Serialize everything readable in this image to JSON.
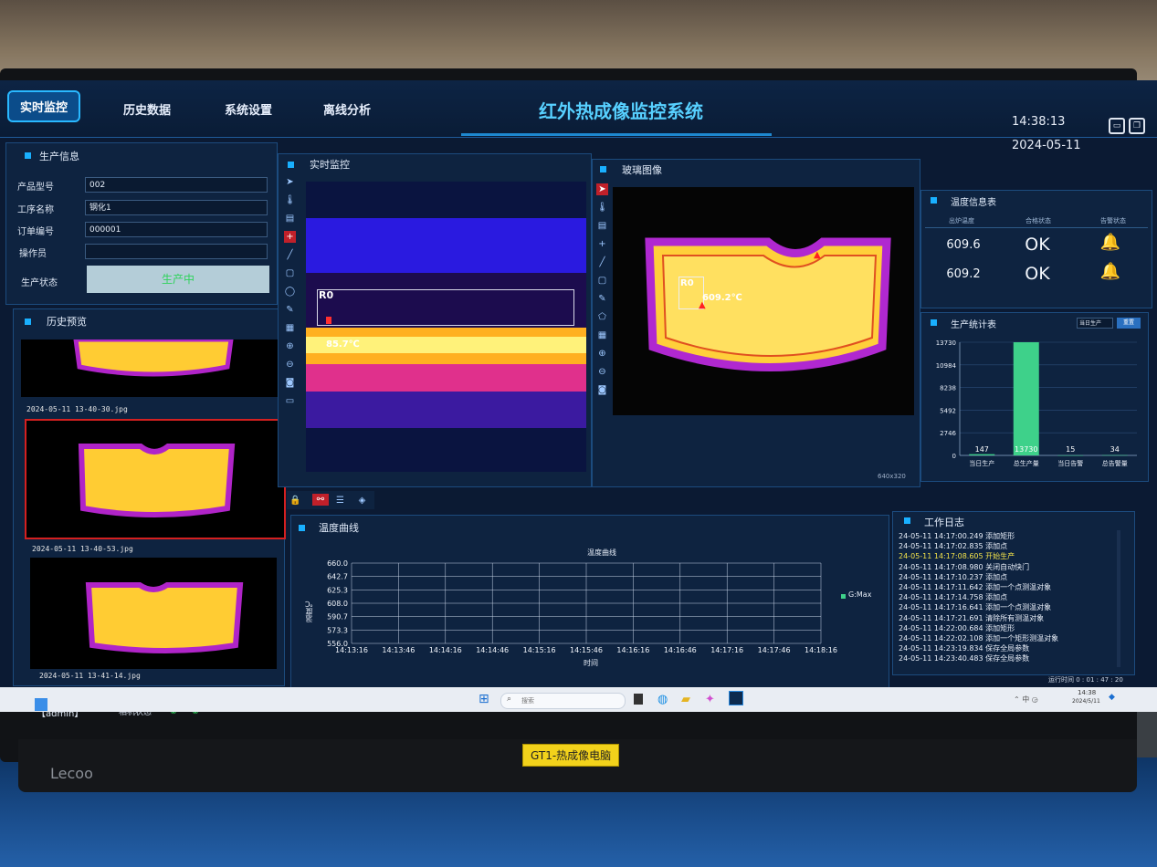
{
  "header": {
    "tabs": [
      "实时监控",
      "历史数据",
      "系统设置",
      "离线分析"
    ],
    "title": "红外热成像监控系统",
    "time": "14:38:13",
    "date": "2024-05-11"
  },
  "production_info": {
    "title": "生产信息",
    "fields": [
      {
        "label": "产品型号",
        "value": "002"
      },
      {
        "label": "工序名称",
        "value": "钢化1"
      },
      {
        "label": "订单编号",
        "value": "000001"
      },
      {
        "label": "操作员",
        "value": ""
      }
    ],
    "status_label": "生产状态",
    "status_value": "生产中"
  },
  "history_preview": {
    "title": "历史预览",
    "files": [
      "2024-05-11 13-40-30.jpg",
      "2024-05-11 13-40-53.jpg",
      "2024-05-11 13-41-14.jpg"
    ]
  },
  "live": {
    "title": "实时监控",
    "roi": "R0",
    "temp": "85.7℃"
  },
  "glass": {
    "title": "玻璃图像",
    "roi": "R0",
    "temp": "609.2℃",
    "resolution": "640x320"
  },
  "temp_table": {
    "title": "温度信息表",
    "headers": [
      "出炉温度",
      "合格状态",
      "告警状态"
    ],
    "rows": [
      {
        "temp": "609.6",
        "status": "OK"
      },
      {
        "temp": "609.2",
        "status": "OK"
      }
    ]
  },
  "stats": {
    "title": "生产统计表",
    "select": "当日生产",
    "button": "重置"
  },
  "chart_data": {
    "type": "bar",
    "categories": [
      "当日生产",
      "总生产量",
      "当日告警",
      "总告警量"
    ],
    "values": [
      147,
      13730,
      15,
      34
    ],
    "ylim": [
      0,
      13730
    ],
    "yticks": [
      0,
      2746,
      5492,
      8238,
      10984,
      13730
    ],
    "grid": true
  },
  "temp_curve": {
    "title": "温度曲线",
    "chart_title": "温度曲线",
    "ylabel": "温度℃",
    "xlabel": "时间",
    "legend": "G:Max",
    "yticks": [
      "660.0",
      "642.7",
      "625.3",
      "608.0",
      "590.7",
      "573.3",
      "556.0"
    ],
    "xticks": [
      "14:13:16",
      "14:13:46",
      "14:14:16",
      "14:14:46",
      "14:15:16",
      "14:15:46",
      "14:16:16",
      "14:16:46",
      "14:17:16",
      "14:17:46",
      "14:18:16"
    ]
  },
  "work_log": {
    "title": "工作日志",
    "entries": [
      "24-05-11 14:17:00.249 添加矩形",
      "24-05-11 14:17:02.835 添加点",
      "24-05-11 14:17:08.605 开始生产",
      "24-05-11 14:17:08.980 关闭自动快门",
      "24-05-11 14:17:10.237 添加点",
      "24-05-11 14:17:11.642 添加一个点测温对象",
      "24-05-11 14:17:14.758 添加点",
      "24-05-11 14:17:16.641 添加一个点测温对象",
      "24-05-11 14:17:21.691 清除所有测温对象",
      "24-05-11 14:22:00.684 添加矩形",
      "24-05-11 14:22:02.108 添加一个矩形测温对象",
      "24-05-11 14:23:19.834 保存全局参数",
      "24-05-11 14:23:40.483 保存全局参数"
    ],
    "highlight_index": 2,
    "runtime": "运行时间 0 : 01 : 47 : 20"
  },
  "status_bar": {
    "user": "【admin】",
    "camera_label": "相机状态"
  },
  "taskbar": {
    "search": "搜索",
    "clock": "14:38",
    "date": "2024/5/11"
  },
  "monitor": {
    "brand": "Lecoo",
    "sticker": "GT1-热成像电脑"
  },
  "colors": {
    "accent": "#19b0ff",
    "panel": "#0e2340",
    "ok_green": "#2fd25c",
    "bar": "#3ed18a"
  }
}
